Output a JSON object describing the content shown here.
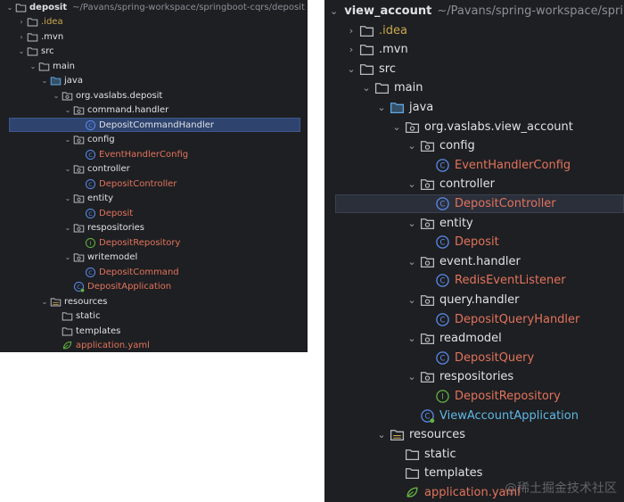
{
  "colors": {
    "folder": "#b9bcc4",
    "source_folder": "#5fa8e6",
    "class_icon": "#5b8def",
    "interface_icon": "#62b543",
    "modified_text": "#e2735c",
    "excluded_text": "#c9a84c",
    "new_text": "#5fb8e6"
  },
  "left_tree": {
    "project_name": "deposit",
    "project_path": "~/Pavans/spring-workspace/springboot-cqrs/deposit",
    "items": [
      {
        "label": "deposit",
        "depth": 0,
        "chevron": "down",
        "icon": "folder-icon",
        "style": "bold"
      },
      {
        "label": ".idea",
        "depth": 1,
        "chevron": "right",
        "icon": "folder-icon",
        "style": "excluded"
      },
      {
        "label": ".mvn",
        "depth": 1,
        "chevron": "right",
        "icon": "folder-icon",
        "style": "default"
      },
      {
        "label": "src",
        "depth": 1,
        "chevron": "down",
        "icon": "folder-icon",
        "style": "default"
      },
      {
        "label": "main",
        "depth": 2,
        "chevron": "down",
        "icon": "folder-icon",
        "style": "default"
      },
      {
        "label": "java",
        "depth": 3,
        "chevron": "down",
        "icon": "source-folder-icon",
        "style": "default"
      },
      {
        "label": "org.vaslabs.deposit",
        "depth": 4,
        "chevron": "down",
        "icon": "package-icon",
        "style": "default"
      },
      {
        "label": "command.handler",
        "depth": 5,
        "chevron": "down",
        "icon": "package-icon",
        "style": "default"
      },
      {
        "label": "DepositCommandHandler",
        "depth": 6,
        "chevron": "none",
        "icon": "class-icon",
        "style": "default",
        "selected": true
      },
      {
        "label": "config",
        "depth": 5,
        "chevron": "down",
        "icon": "package-icon",
        "style": "default"
      },
      {
        "label": "EventHandlerConfig",
        "depth": 6,
        "chevron": "none",
        "icon": "class-icon",
        "style": "modified"
      },
      {
        "label": "controller",
        "depth": 5,
        "chevron": "down",
        "icon": "package-icon",
        "style": "default"
      },
      {
        "label": "DepositController",
        "depth": 6,
        "chevron": "none",
        "icon": "class-icon",
        "style": "modified"
      },
      {
        "label": "entity",
        "depth": 5,
        "chevron": "down",
        "icon": "package-icon",
        "style": "default"
      },
      {
        "label": "Deposit",
        "depth": 6,
        "chevron": "none",
        "icon": "class-icon",
        "style": "modified"
      },
      {
        "label": "respositories",
        "depth": 5,
        "chevron": "down",
        "icon": "package-icon",
        "style": "default"
      },
      {
        "label": "DepositRepository",
        "depth": 6,
        "chevron": "none",
        "icon": "interface-icon",
        "style": "modified"
      },
      {
        "label": "writemodel",
        "depth": 5,
        "chevron": "down",
        "icon": "package-icon",
        "style": "default"
      },
      {
        "label": "DepositCommand",
        "depth": 6,
        "chevron": "none",
        "icon": "class-icon",
        "style": "modified"
      },
      {
        "label": "DepositApplication",
        "depth": 5,
        "chevron": "none",
        "icon": "spring-class-icon",
        "style": "modified"
      },
      {
        "label": "resources",
        "depth": 3,
        "chevron": "down",
        "icon": "resources-folder-icon",
        "style": "default"
      },
      {
        "label": "static",
        "depth": 4,
        "chevron": "none",
        "icon": "folder-icon",
        "style": "default"
      },
      {
        "label": "templates",
        "depth": 4,
        "chevron": "none",
        "icon": "folder-icon",
        "style": "default"
      },
      {
        "label": "application.yaml",
        "depth": 4,
        "chevron": "none",
        "icon": "yaml-icon",
        "style": "modified"
      }
    ]
  },
  "right_tree": {
    "project_name": "view_account",
    "project_path": "~/Pavans/spring-workspace/spring",
    "items": [
      {
        "label": "view_account",
        "depth": 0,
        "chevron": "down",
        "icon": "folder-icon",
        "style": "bold"
      },
      {
        "label": ".idea",
        "depth": 1,
        "chevron": "right",
        "icon": "folder-icon",
        "style": "excluded"
      },
      {
        "label": ".mvn",
        "depth": 1,
        "chevron": "right",
        "icon": "folder-icon",
        "style": "default"
      },
      {
        "label": "src",
        "depth": 1,
        "chevron": "down",
        "icon": "folder-icon",
        "style": "default"
      },
      {
        "label": "main",
        "depth": 2,
        "chevron": "down",
        "icon": "folder-icon",
        "style": "default"
      },
      {
        "label": "java",
        "depth": 3,
        "chevron": "down",
        "icon": "source-folder-icon",
        "style": "default"
      },
      {
        "label": "org.vaslabs.view_account",
        "depth": 4,
        "chevron": "down",
        "icon": "package-icon",
        "style": "default"
      },
      {
        "label": "config",
        "depth": 5,
        "chevron": "down",
        "icon": "package-icon",
        "style": "default"
      },
      {
        "label": "EventHandlerConfig",
        "depth": 6,
        "chevron": "none",
        "icon": "class-icon",
        "style": "modified"
      },
      {
        "label": "controller",
        "depth": 5,
        "chevron": "down",
        "icon": "package-icon",
        "style": "default"
      },
      {
        "label": "DepositController",
        "depth": 6,
        "chevron": "none",
        "icon": "class-icon",
        "style": "modified",
        "selected": true
      },
      {
        "label": "entity",
        "depth": 5,
        "chevron": "down",
        "icon": "package-icon",
        "style": "default"
      },
      {
        "label": "Deposit",
        "depth": 6,
        "chevron": "none",
        "icon": "class-icon",
        "style": "modified"
      },
      {
        "label": "event.handler",
        "depth": 5,
        "chevron": "down",
        "icon": "package-icon",
        "style": "default"
      },
      {
        "label": "RedisEventListener",
        "depth": 6,
        "chevron": "none",
        "icon": "class-icon",
        "style": "modified"
      },
      {
        "label": "query.handler",
        "depth": 5,
        "chevron": "down",
        "icon": "package-icon",
        "style": "default"
      },
      {
        "label": "DepositQueryHandler",
        "depth": 6,
        "chevron": "none",
        "icon": "class-icon",
        "style": "modified"
      },
      {
        "label": "readmodel",
        "depth": 5,
        "chevron": "down",
        "icon": "package-icon",
        "style": "default"
      },
      {
        "label": "DepositQuery",
        "depth": 6,
        "chevron": "none",
        "icon": "class-icon",
        "style": "modified"
      },
      {
        "label": "respositories",
        "depth": 5,
        "chevron": "down",
        "icon": "package-icon",
        "style": "default"
      },
      {
        "label": "DepositRepository",
        "depth": 6,
        "chevron": "none",
        "icon": "interface-icon",
        "style": "modified"
      },
      {
        "label": "ViewAccountApplication",
        "depth": 5,
        "chevron": "none",
        "icon": "spring-class-icon",
        "style": "new"
      },
      {
        "label": "resources",
        "depth": 3,
        "chevron": "down",
        "icon": "resources-folder-icon",
        "style": "default"
      },
      {
        "label": "static",
        "depth": 4,
        "chevron": "none",
        "icon": "folder-icon",
        "style": "default"
      },
      {
        "label": "templates",
        "depth": 4,
        "chevron": "none",
        "icon": "folder-icon",
        "style": "default"
      },
      {
        "label": "application.yaml",
        "depth": 4,
        "chevron": "none",
        "icon": "yaml-icon",
        "style": "modified"
      }
    ]
  },
  "watermark": "@稀土掘金技术社区"
}
